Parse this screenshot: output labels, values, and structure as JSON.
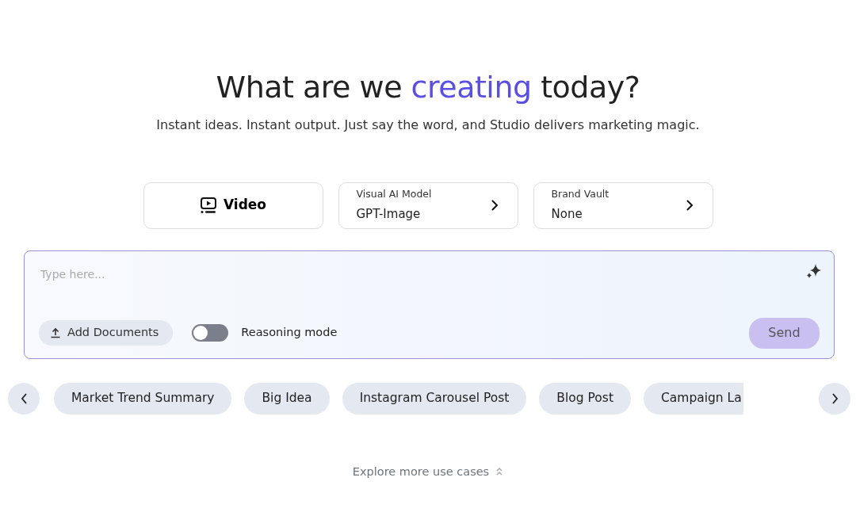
{
  "heading": "What are we **creating** today?",
  "subheading": "Instant ideas. Instant output. Just say the word, and Studio delivers marketing magic.",
  "mode_button": {
    "label": "Video"
  },
  "selectors": [
    {
      "label": "Visual AI Model",
      "value": "GPT-Image"
    },
    {
      "label": "Brand Vault",
      "value": "None"
    }
  ],
  "prompt": {
    "placeholder": "Type here...",
    "add_documents": "Add Documents",
    "reasoning_mode": {
      "label": "Reasoning mode",
      "on": false
    },
    "send": "Send",
    "send_disabled": true
  },
  "suggestions": [
    {
      "label": "Market Trend Summary"
    },
    {
      "label": "Big Idea"
    },
    {
      "label": "Instagram Carousel Post"
    },
    {
      "label": "Blog Post"
    },
    {
      "label": "Campaign La"
    }
  ],
  "explore_link": "Explore more use cases"
}
